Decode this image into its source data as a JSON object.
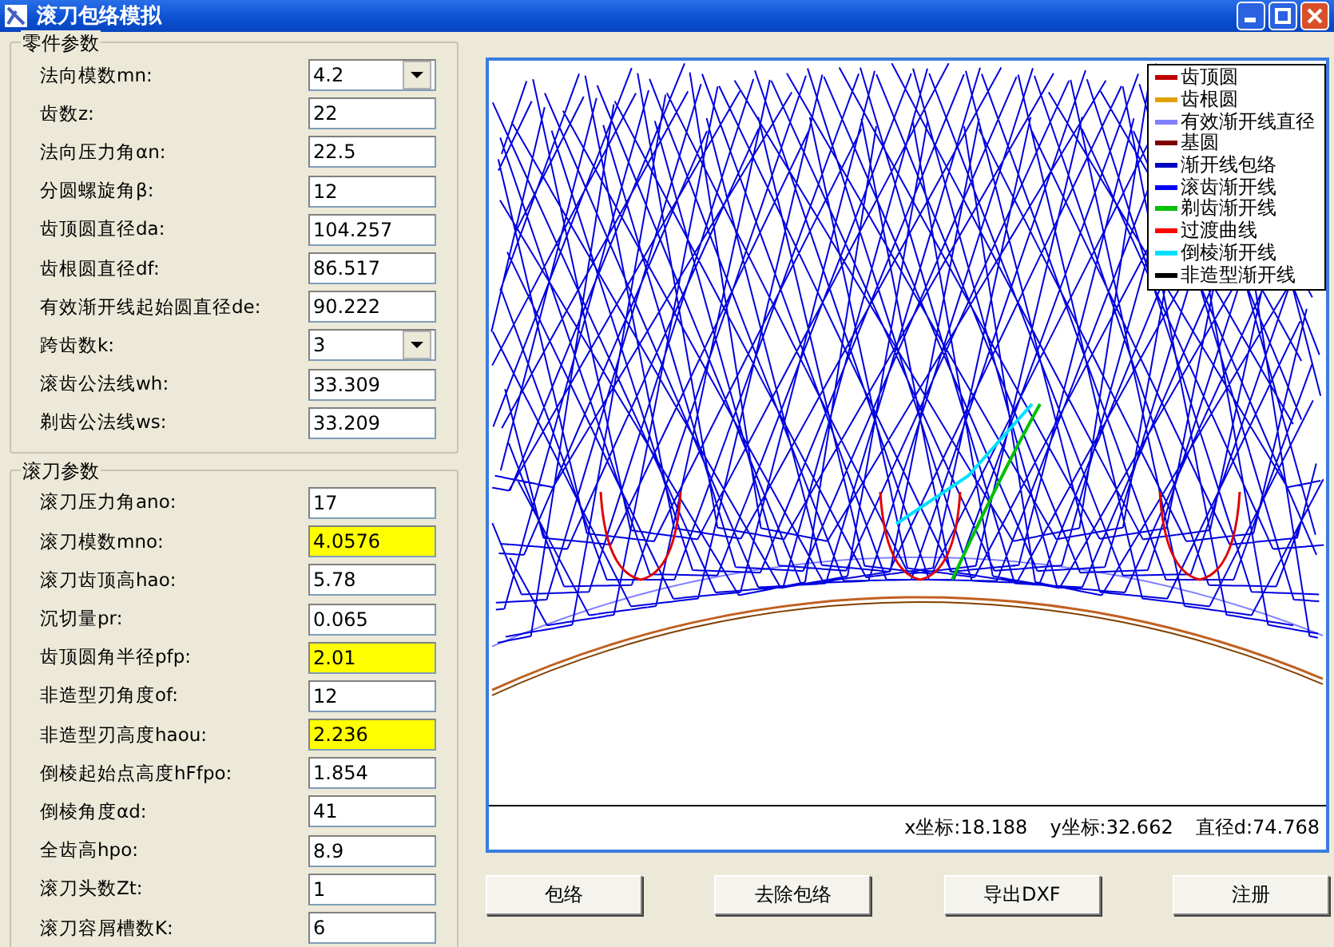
{
  "window": {
    "title": "滚刀包络模拟"
  },
  "groups": [
    {
      "title": "零件参数",
      "fields": [
        {
          "label": "法向模数mn:",
          "value": "4.2",
          "kind": "select",
          "highlighted": false
        },
        {
          "label": "齿数z:",
          "value": "22",
          "kind": "text",
          "highlighted": false
        },
        {
          "label": "法向压力角αn:",
          "value": "22.5",
          "kind": "text",
          "highlighted": false
        },
        {
          "label": "分圆螺旋角β:",
          "value": "12",
          "kind": "text",
          "highlighted": false
        },
        {
          "label": "齿顶圆直径da:",
          "value": "104.257",
          "kind": "text",
          "highlighted": false
        },
        {
          "label": "齿根圆直径df:",
          "value": "86.517",
          "kind": "text",
          "highlighted": false
        },
        {
          "label": "有效渐开线起始圆直径de:",
          "value": "90.222",
          "kind": "text",
          "highlighted": false
        },
        {
          "label": "跨齿数k:",
          "value": "3",
          "kind": "select",
          "highlighted": false
        },
        {
          "label": "滚齿公法线wh:",
          "value": "33.309",
          "kind": "text",
          "highlighted": false
        },
        {
          "label": "剃齿公法线ws:",
          "value": "33.209",
          "kind": "text",
          "highlighted": false
        }
      ]
    },
    {
      "title": "滚刀参数",
      "fields": [
        {
          "label": "滚刀压力角ano:",
          "value": "17",
          "kind": "text",
          "highlighted": false
        },
        {
          "label": "滚刀模数mno:",
          "value": "4.0576",
          "kind": "text",
          "highlighted": true
        },
        {
          "label": "滚刀齿顶高hao:",
          "value": "5.78",
          "kind": "text",
          "highlighted": false
        },
        {
          "label": "沉切量pr:",
          "value": "0.065",
          "kind": "text",
          "highlighted": false
        },
        {
          "label": "齿顶圆角半径pfp:",
          "value": "2.01",
          "kind": "text",
          "highlighted": true
        },
        {
          "label": "非造型刃角度of:",
          "value": "12",
          "kind": "text",
          "highlighted": false
        },
        {
          "label": "非造型刃高度haou:",
          "value": "2.236",
          "kind": "text",
          "highlighted": true
        },
        {
          "label": "倒棱起始点高度hFfpo:",
          "value": "1.854",
          "kind": "text",
          "highlighted": false
        },
        {
          "label": "倒棱角度αd:",
          "value": "41",
          "kind": "text",
          "highlighted": false
        },
        {
          "label": "全齿高hpo:",
          "value": "8.9",
          "kind": "text",
          "highlighted": false
        },
        {
          "label": "滚刀头数Zt:",
          "value": "1",
          "kind": "text",
          "highlighted": false
        },
        {
          "label": "滚刀容屑槽数K:",
          "value": "6",
          "kind": "text",
          "highlighted": false
        }
      ]
    }
  ],
  "legend": [
    {
      "label": "齿顶圆",
      "color": "#c00000"
    },
    {
      "label": "齿根圆",
      "color": "#e0a000"
    },
    {
      "label": "有效渐开线直径",
      "color": "#8080ff"
    },
    {
      "label": "基圆",
      "color": "#800000"
    },
    {
      "label": "渐开线包络",
      "color": "#0000c0"
    },
    {
      "label": "滚齿渐开线",
      "color": "#0000ff"
    },
    {
      "label": "剃齿渐开线",
      "color": "#00c000"
    },
    {
      "label": "过渡曲线",
      "color": "#ff0000"
    },
    {
      "label": "倒棱渐开线",
      "color": "#00e0ff"
    },
    {
      "label": "非造型渐开线",
      "color": "#000000"
    }
  ],
  "status": [
    "x坐标:18.188",
    "y坐标:32.662",
    "直径d:74.768"
  ],
  "buttons": [
    "包络",
    "去除包络",
    "导出DXF",
    "注册"
  ]
}
